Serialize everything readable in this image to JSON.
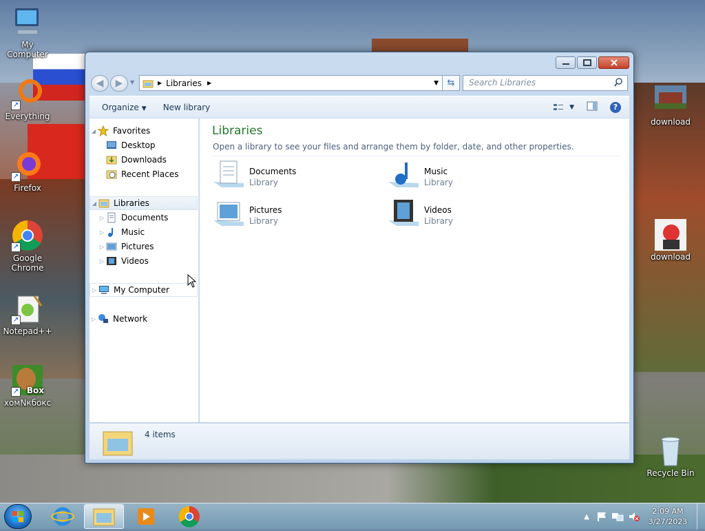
{
  "desktop": {
    "icons": [
      {
        "label": "My Computer"
      },
      {
        "label": "Everything"
      },
      {
        "label": "Firefox"
      },
      {
        "label": "Google Chrome"
      },
      {
        "label": "Notepad++"
      },
      {
        "label": "хомNкбокс",
        "badge": "Box"
      },
      {
        "label": "download"
      },
      {
        "label": "download"
      },
      {
        "label": "Recycle Bin"
      }
    ]
  },
  "window": {
    "breadcrumb": "Libraries",
    "search_placeholder": "Search Libraries",
    "toolbar": {
      "organize": "Organize",
      "new_library": "New library"
    },
    "nav": {
      "favorites": "Favorites",
      "desktop": "Desktop",
      "downloads": "Downloads",
      "recent_places": "Recent Places",
      "libraries": "Libraries",
      "documents": "Documents",
      "music": "Music",
      "pictures": "Pictures",
      "videos": "Videos",
      "my_computer": "My Computer",
      "network": "Network"
    },
    "main": {
      "title": "Libraries",
      "subtitle": "Open a library to see your files and arrange them by folder, date, and other properties.",
      "items": [
        {
          "name": "Documents",
          "type": "Library"
        },
        {
          "name": "Music",
          "type": "Library"
        },
        {
          "name": "Pictures",
          "type": "Library"
        },
        {
          "name": "Videos",
          "type": "Library"
        }
      ]
    },
    "status": "4 items"
  },
  "taskbar": {
    "time": "2:09 AM",
    "date": "3/27/2023"
  },
  "colors": {
    "title_green": "#1d7a2a",
    "window_frame": "#bcd2ea",
    "close_red": "#c4412a"
  }
}
